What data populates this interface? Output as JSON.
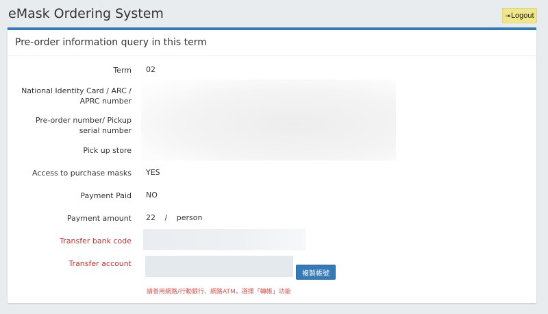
{
  "header": {
    "app_title": "eMask Ordering System",
    "logout_label": "Logout",
    "logout_icon": "logout-icon"
  },
  "panel": {
    "title": "Pre-order information query in this term",
    "rows": {
      "term": {
        "label": "Term",
        "value": "02"
      },
      "id_number": {
        "label": "National Identity Card / ARC / APRC number",
        "value": ""
      },
      "serial": {
        "label": "Pre-order number/ Pickup serial number",
        "value": ""
      },
      "store": {
        "label": "Pick up store",
        "value": ""
      },
      "access": {
        "label": "Access to purchase masks",
        "value": "YES"
      },
      "paid": {
        "label": "Payment Paid",
        "value": "NO"
      },
      "amount": {
        "label": "Payment amount",
        "value_amount": "22",
        "value_sep": "/",
        "value_unit": "person"
      },
      "bank_code": {
        "label": "Transfer bank code"
      },
      "account": {
        "label": "Transfer account"
      }
    },
    "copy_button_label": "複製帳號",
    "notice": "請善用網路/行動銀行、網路ATM，選擇「轉帳」功能"
  },
  "colors": {
    "accent": "#337ab7",
    "logout_bg": "#f0e68c",
    "warning_text": "#c9302c"
  }
}
